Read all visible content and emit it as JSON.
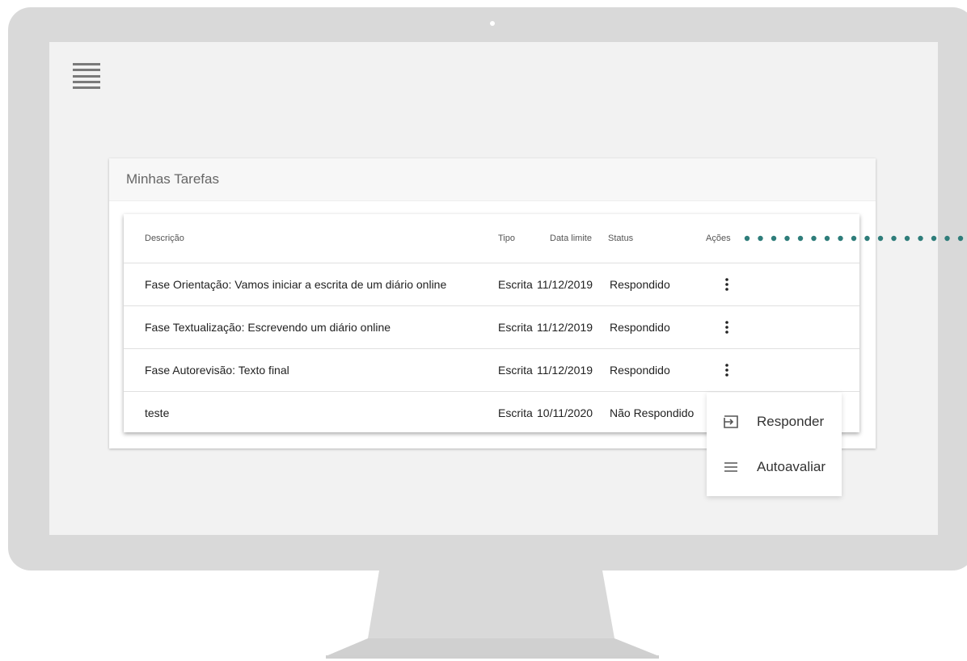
{
  "panel": {
    "title": "Minhas Tarefas"
  },
  "table": {
    "headers": {
      "descricao": "Descrição",
      "tipo": "Tipo",
      "data_limite": "Data limite",
      "status": "Status",
      "acoes": "Ações"
    },
    "rows": [
      {
        "descricao": "Fase Orientação: Vamos iniciar a escrita de um diário online",
        "tipo": "Escrita",
        "data_limite": "11/12/2019",
        "status": "Respondido"
      },
      {
        "descricao": "Fase Textualização: Escrevendo um diário online",
        "tipo": "Escrita",
        "data_limite": "11/12/2019",
        "status": "Respondido"
      },
      {
        "descricao": "Fase Autorevisão: Texto final",
        "tipo": "Escrita",
        "data_limite": "11/12/2019",
        "status": "Respondido"
      },
      {
        "descricao": "teste",
        "tipo": "Escrita",
        "data_limite": "10/11/2020",
        "status": "Não Respondido"
      }
    ]
  },
  "menu": {
    "items": [
      {
        "label": "Responder",
        "icon": "login-arrow-icon"
      },
      {
        "label": "Autoavaliar",
        "icon": "list-lines-icon"
      }
    ]
  },
  "icons": {
    "menu": "hamburger-menu-icon",
    "actions": "more-vertical-icon"
  },
  "colors": {
    "accent": "#2e7d7a",
    "screen_bg": "#f2f2f2",
    "bezel": "#d9d9d9"
  }
}
